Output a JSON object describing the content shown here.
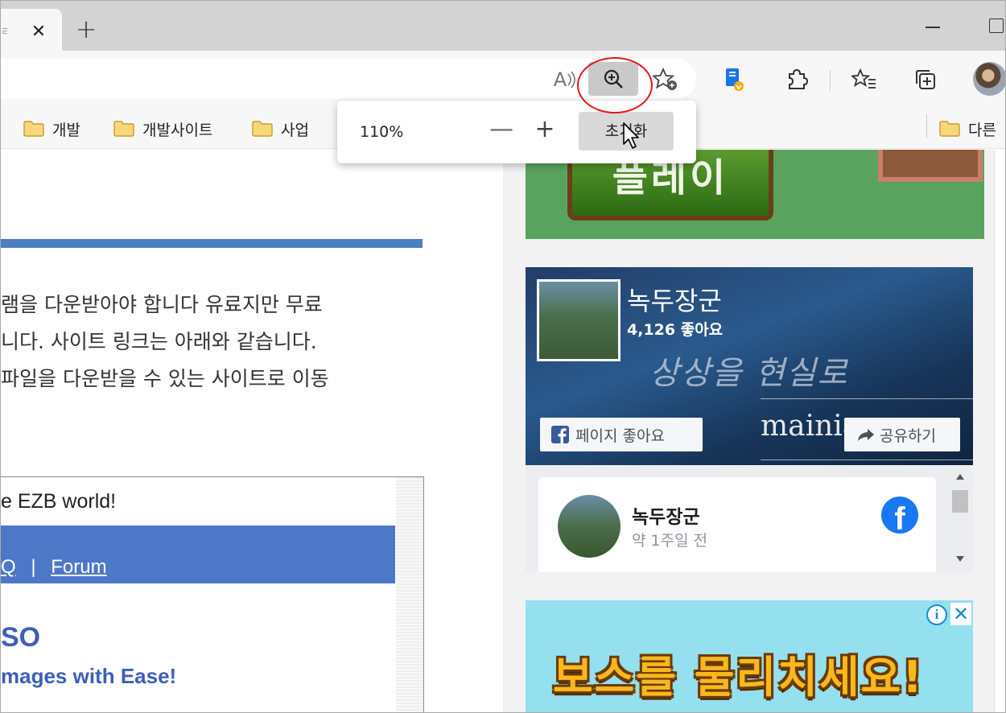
{
  "browser": {
    "tab": {
      "close_glyph": "✕",
      "favicon_text": "ㄹ ㅎ"
    },
    "new_tab_glyph": "+",
    "toolbar": {
      "read_aloud_label": "A",
      "icons": [
        "read-aloud-icon",
        "zoom-in-icon",
        "add-favorite-icon",
        "extension-icon",
        "puzzle-icon",
        "favorites-icon",
        "collections-icon",
        "profile-avatar"
      ]
    },
    "bookmarks": [
      {
        "label": "개발"
      },
      {
        "label": "개발사이트"
      },
      {
        "label": "사업"
      },
      {
        "label": "다른"
      }
    ],
    "zoom_popup": {
      "level": "110%",
      "minus": "—",
      "plus": "+",
      "reset_label": "초기화"
    }
  },
  "article": {
    "lines": [
      "램을 다운받아야 합니다 유료지만 무료",
      " 니다. 사이트 링크는 아래와 같습니다.",
      "파일을 다운받을 수 있는 사이트로 이동"
    ],
    "embed": {
      "welcome": "e EZB world!",
      "nav_prefix": "Q",
      "nav_sep": "|",
      "nav_link": "Forum",
      "product": "SO",
      "tagline": "mages with Ease!"
    }
  },
  "sidebar": {
    "game_banner": {
      "play_label": "플레이"
    },
    "facebook_page": {
      "name": "녹두장군",
      "likes": "4,126 좋아요",
      "slogan": "상상을 현실로",
      "domain": "mainia",
      "like_button": "페이지 좋아요",
      "share_button": "공유하기"
    },
    "post": {
      "author": "녹두장군",
      "time": "약 1주일 전",
      "fb_logo": "f"
    },
    "ad": {
      "text": "보스를 물리치세요!",
      "info_glyph": "i",
      "close_glyph": "✕"
    }
  },
  "colors": {
    "accent_blue": "#4a7fc0",
    "annotation_red": "#e8141b",
    "facebook_blue": "#1877f2",
    "folder_yellow": "#f5c242"
  }
}
